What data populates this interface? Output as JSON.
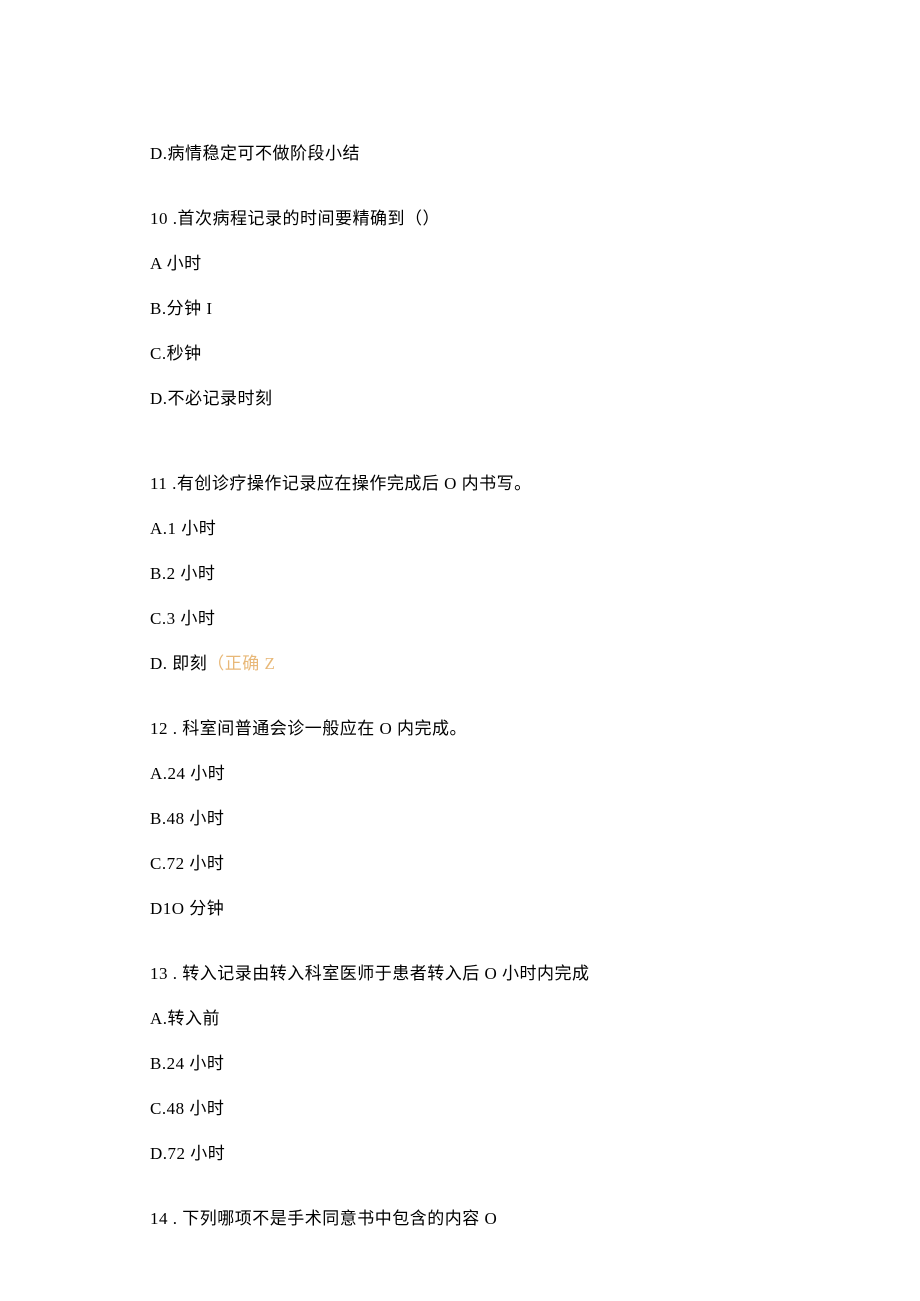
{
  "q9": {
    "optD": "D.病情稳定可不做阶段小结"
  },
  "q10": {
    "stem": "10   .首次病程记录的时间要精确到（）",
    "optA": "A 小时",
    "optB": "B.分钟 I",
    "optC": "C.秒钟",
    "optD": "D.不必记录时刻"
  },
  "q11": {
    "stem": "11  .有创诊疗操作记录应在操作完成后 O 内书写。",
    "optA": "A.1 小时",
    "optB": "B.2 小时",
    "optC": "C.3 小时",
    "optD_prefix": "D. 即刻",
    "optD_highlight": "（正确 Z"
  },
  "q12": {
    "stem": "12   . 科室间普通会诊一般应在 O 内完成。",
    "optA": "A.24 小时",
    "optB": "B.48 小时",
    "optC": "C.72 小时",
    "optD": "D1O 分钟"
  },
  "q13": {
    "stem": "13   . 转入记录由转入科室医师于患者转入后 O 小时内完成",
    "optA": "A.转入前",
    "optB": "B.24 小时",
    "optC": "C.48 小时",
    "optD": "D.72 小时"
  },
  "q14": {
    "stem": "14   . 下列哪项不是手术同意书中包含的内容 O"
  }
}
